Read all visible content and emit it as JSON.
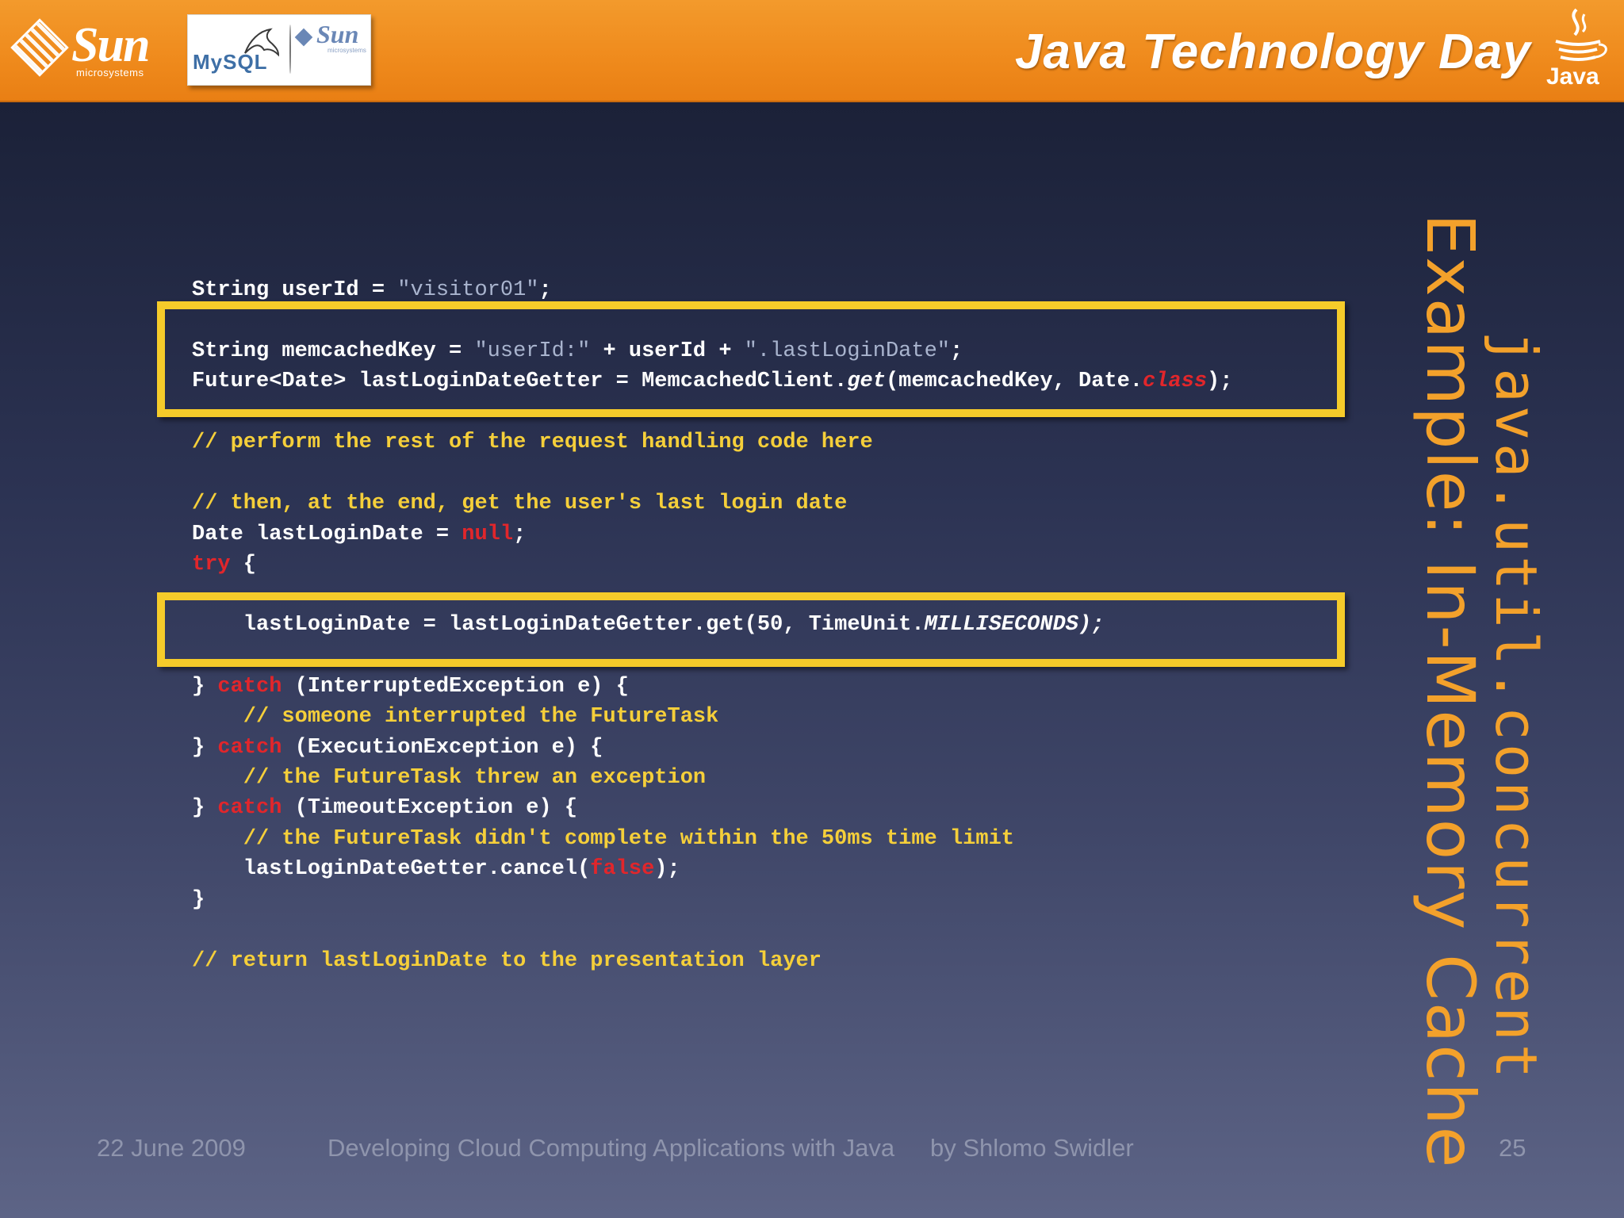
{
  "header": {
    "sun_logo_text": "Sun",
    "sun_logo_subtext": "microsystems",
    "partner_mysql_text": "MySQL",
    "partner_sun_text": "Sun",
    "partner_sun_subtext": "microsystems",
    "event_title": "Java Technology Day",
    "java_logo_text": "Java"
  },
  "slide": {
    "title_line1": "Example: In-Memory Cache",
    "title_line2": "java.util.concurrent",
    "code": {
      "l1_a": "String userId = ",
      "l1_str": "\"visitor01\"",
      "l1_b": ";",
      "l2_a": "String memcachedKey = ",
      "l2_str1": "\"userId:\"",
      "l2_b": " + userId + ",
      "l2_str2": "\".lastLoginDate\"",
      "l2_c": ";",
      "l3_a": "Future<Date> lastLoginDateGetter = MemcachedClient.",
      "l3_get": "get",
      "l3_b": "(memcachedKey, Date.",
      "l3_class": "class",
      "l3_c": ");",
      "l4": "// perform the rest of the request handling code here",
      "l5": "// then, at the end, get the user's last login date",
      "l6_a": "Date lastLoginDate = ",
      "l6_null": "null",
      "l6_b": ";",
      "l7_try": "try",
      "l7_b": " {",
      "l8_a": "    lastLoginDate = lastLoginDateGetter.get(50, TimeUnit.",
      "l8_ms": "MILLISECONDS);",
      "l9_a": "} ",
      "l9_catch": "catch",
      "l9_b": " (InterruptedException e) {",
      "l10": "    // someone interrupted the FutureTask",
      "l11_a": "} ",
      "l11_catch": "catch",
      "l11_b": " (ExecutionException e) {",
      "l12": "    // the FutureTask threw an exception",
      "l13_a": "} ",
      "l13_catch": "catch",
      "l13_b": " (TimeoutException e) {",
      "l14": "    // the FutureTask didn't complete within the 50ms time limit",
      "l15_a": "    lastLoginDateGetter.cancel(",
      "l15_false": "false",
      "l15_b": ");",
      "l16": "}",
      "l17": "// return lastLoginDate to the presentation layer"
    }
  },
  "footer": {
    "date": "22 June 2009",
    "talk_title": "Developing Cloud Computing Applications with Java",
    "author": "by Shlomo Swidler",
    "page_number": "25"
  },
  "colors": {
    "header_orange": "#ef8a1c",
    "highlight_yellow": "#f5cb2a",
    "comment_yellow": "#f5cf3a",
    "keyword_red": "#e1262b",
    "title_orange": "#f3a12b"
  }
}
